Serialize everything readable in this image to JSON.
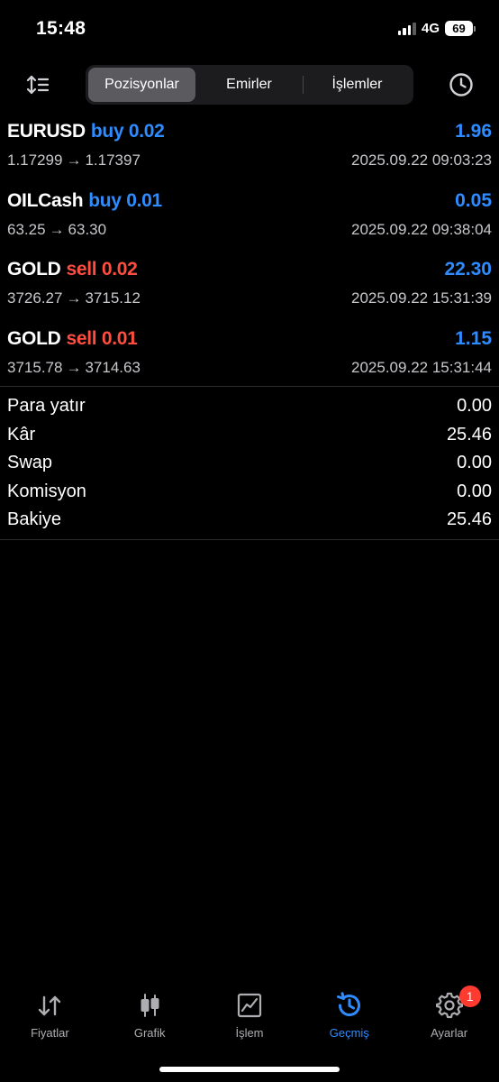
{
  "status_bar": {
    "time": "15:48",
    "network": "4G",
    "battery": "69"
  },
  "header": {
    "tabs": [
      {
        "label": "Pozisyonlar",
        "active": true
      },
      {
        "label": "Emirler",
        "active": false
      },
      {
        "label": "İşlemler",
        "active": false
      }
    ],
    "sort_icon": "sort-icon",
    "history_icon": "clock-icon"
  },
  "trades": [
    {
      "symbol": "EURUSD",
      "side": "buy 0.02",
      "profit": "1.96",
      "open_price": "1.17299",
      "close_price": "1.17397",
      "time": "2025.09.22 09:03:23"
    },
    {
      "symbol": "OILCash",
      "side": "buy 0.01",
      "profit": "0.05",
      "open_price": "63.25",
      "close_price": "63.30",
      "time": "2025.09.22 09:38:04"
    },
    {
      "symbol": "GOLD",
      "side": "sell 0.02",
      "profit": "22.30",
      "open_price": "3726.27",
      "close_price": "3715.12",
      "time": "2025.09.22 15:31:39"
    },
    {
      "symbol": "GOLD",
      "side": "sell 0.01",
      "profit": "1.15",
      "open_price": "3715.78",
      "close_price": "3714.63",
      "time": "2025.09.22 15:31:44"
    }
  ],
  "summary": [
    {
      "label": "Para yatır",
      "value": "0.00"
    },
    {
      "label": "Kâr",
      "value": "25.46"
    },
    {
      "label": "Swap",
      "value": "0.00"
    },
    {
      "label": "Komisyon",
      "value": "0.00"
    },
    {
      "label": "Bakiye",
      "value": "25.46"
    }
  ],
  "tabbar": {
    "items": [
      {
        "label": "Fiyatlar",
        "icon": "quotes-arrows-icon"
      },
      {
        "label": "Grafik",
        "icon": "candlestick-icon"
      },
      {
        "label": "İşlem",
        "icon": "trade-chart-icon"
      },
      {
        "label": "Geçmiş",
        "icon": "history-icon"
      },
      {
        "label": "Ayarlar",
        "icon": "gear-icon",
        "badge": "1"
      }
    ]
  },
  "colors": {
    "accent_blue": "#2f8cff",
    "sell_red": "#ff4d3f",
    "background": "#000000",
    "badge_red": "#ff3b30"
  }
}
